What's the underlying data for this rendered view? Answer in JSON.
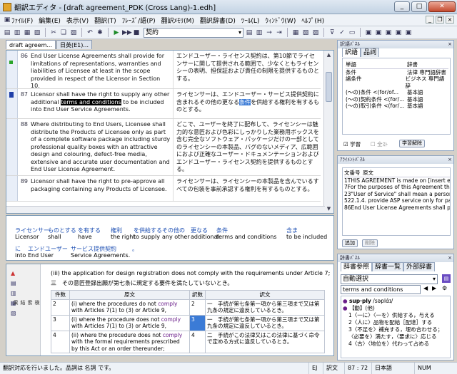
{
  "window": {
    "title": "翻訳エディタ - [draft agreement_PDK (Cross Lang)-1.edh]",
    "btn_min": "_",
    "btn_max": "□",
    "btn_close": "✕"
  },
  "menu": [
    "ﾌｧｲﾙ(F)",
    "編集(E)",
    "表示(V)",
    "翻訳(T)",
    "ﾌﾚｰｽﾞ/語(P)",
    "翻訳ﾒﾓﾘ(M)",
    "翻訳辞書(D)",
    "ﾂｰﾙ(L)",
    "ｳｨﾝﾄﾞｳ(W)",
    "ﾍﾙﾌﾟ(H)"
  ],
  "toolbar": {
    "mode_value": "契約"
  },
  "tabs": [
    "draft agreem...",
    "日英(E1)..."
  ],
  "segments": [
    {
      "num": "86",
      "src": "End User License Agreements shall provide for limitations of representations, warranties and liabilities of Licensee at least in the scope provided in respect of the Licensor in Section 10.",
      "tgt": "エンドユーザー・ライセンス契約は、第10節でライセンサーに関して提供される範囲で、少なくともライセンシーの表明、担保証および責任の制限を提供するものとする。"
    },
    {
      "num": "87",
      "src_a": "Licensor shall have the right to supply any other additional ",
      "src_hl": "terms and conditions",
      "src_b": " to be included into End User Service Agreements.",
      "tgt_a": "ライセンサーは、エンドユーザー・サービス提供契約に含まれるその他の更なる",
      "tgt_hl": "条件",
      "tgt_b": "を供給する権利を有するものとする。"
    },
    {
      "num": "88",
      "src": "Where distributing to End Users, Licensee shall distribute the Products of Licensee only as part of a complete software package including sturdy professional quality boxes with an attractive design and colouring, defect-free media, extensive and accurate user documentation and End User License Agreement.",
      "tgt": "どこで、ユーザーを終了に配布して、ライセンシーは魅力的な意匠および色彩にしっかりした業務用ボックスを含む完全なソフトウェア・パッケージだけの一部としてのライセンシーの本製品、バグのないメディア、広範囲におよび正確なユーザー・ドキュメンテーションおよびエンドユーザー・ライセンス契約を提供するものとする。"
    },
    {
      "num": "89",
      "src": "Licensor shall have the right to pre-approve all packaging containing any Products of Licensee.",
      "tgt": "ライセンサーは、ライセンシーの本製品を含んでいるすべての包装を事前承認する権利を有するものとする。"
    }
  ],
  "parse": {
    "row1": [
      {
        "ja": "ライセンサー",
        "en": "Licensor"
      },
      {
        "ja": "ものとする",
        "en": "shall"
      },
      {
        "ja": "を有する",
        "en": "have"
      },
      {
        "ja": "権利",
        "en": "the right"
      },
      {
        "ja": "を供給する",
        "en": "to supply"
      },
      {
        "ja": "その他の",
        "en": "any other"
      },
      {
        "ja": "更なる",
        "en": "additional"
      },
      {
        "ja": "条件",
        "en": "terms and conditions"
      },
      {
        "ja": "含ま",
        "en": "to be included"
      }
    ],
    "row2": [
      {
        "ja": "に",
        "en": "into"
      },
      {
        "ja": "エンドユーザー",
        "en": "End User"
      },
      {
        "ja": "サービス提供契約",
        "en": "Service Agreements."
      },
      {
        "ja": "。",
        "en": ""
      }
    ]
  },
  "lower": {
    "line1": "(iii) the application for design registration does not comply with the requirements under Article 7;",
    "line2": "三　その意匠登録出願が第七条に規定する要件を満たしていないとき。",
    "headers": {
      "count": "件数",
      "src": "原文",
      "yaku": "訳数",
      "tgt": "訳文"
    },
    "rows": [
      {
        "count": "2",
        "src_a": "(i)  where the procedures do not ",
        "src_hl": "comply",
        "src_b": " with Articles 7(1) to (3) or Article 9,",
        "yaku": "2",
        "tgt": "一　手続が第七条第一項から第三項まで又は第九条の規定に違反しているとき。"
      },
      {
        "count": "3",
        "src_a": "(i)  where the procedure does not ",
        "src_hl": "comply",
        "src_b": " with Articles 7(1) to (3) or Article 9,",
        "yaku": "3",
        "tgt": "一　手続が第七条第一項から第三項まで又は第九条の規定に違反しているとき。"
      },
      {
        "count": "4",
        "src_a": "(ii) where the procedure does not ",
        "src_hl": "comply",
        "src_b": " with the formal requirements prescribed by this Act or an order thereunder;",
        "yaku": "4",
        "tgt": "二　手続がこの法律又はこの法律に基づく命令で定める方式に違反しているとき。"
      }
    ],
    "side_label": "検索結果"
  },
  "rp1": {
    "title": "訳語ﾊﾟﾈﾙ",
    "tabs": [
      "訳語",
      "品詞"
    ],
    "col_word": "単語",
    "col_dict": "辞書",
    "rows": [
      {
        "w": "条件",
        "d": "法律 専門語辞書"
      },
      {
        "w": "諸条件",
        "d": "ビジネス 専門語辞"
      },
      {
        "w": "(〜の)条件 <(for/of...",
        "d": "基本語"
      },
      {
        "w": "(〜の)契約条件 <(for/...",
        "d": "基本語"
      },
      {
        "w": "(〜の)取引条件 <(for/...",
        "d": "基本語"
      }
    ],
    "cb_learn": "学習",
    "cb_all": "全ｽﾄ",
    "btn_learn_clear": "学習解除"
  },
  "rp2": {
    "title": "ｱﾗｲﾒﾝﾄﾊﾟﾈﾙ",
    "col_no": "文番号",
    "col_src": "原文",
    "rows": [
      {
        "n": "1",
        "t": "THIS AGREEMENT is made on [insert effe..."
      },
      {
        "n": "7",
        "t": "For the purposes of this Agreement the f..."
      },
      {
        "n": "23",
        "t": "\"User of Service\" shall mean a person or ..."
      },
      {
        "n": "52",
        "t": "2.1.4. provide ASP service only for paym..."
      },
      {
        "n": "86",
        "t": "End User License Agreements shall provi..."
      }
    ],
    "btn_add": "追加",
    "btn_del": "削除"
  },
  "rp3": {
    "title": "辞書ﾊﾟﾈﾙ",
    "tabs": [
      "辞書参照",
      "辞書一覧",
      "外部辞書"
    ],
    "select": "自動選択",
    "search": "terms and conditions",
    "entry_hw": "sup·ply",
    "entry_pron": "/səplάɪ/",
    "entry_pos": "【動】(他)",
    "senses": [
      "1〈一に〉〈一を〉供給する，与える",
      "2〈人に〉品物を配給［配達］する",
      "3〈不足を〉補充する，埋め合わせる；〈必要を〉満たす，〈要求に〉応じる",
      "4〈古〉〈地位を〉代わって占める"
    ]
  },
  "status": {
    "message": "翻訳対応を行いました。品詞は 名詞 です。",
    "lang": "EJ",
    "mode": "訳文",
    "pos": "87 : 72",
    "ime": "日本語",
    "num": "NUM"
  }
}
